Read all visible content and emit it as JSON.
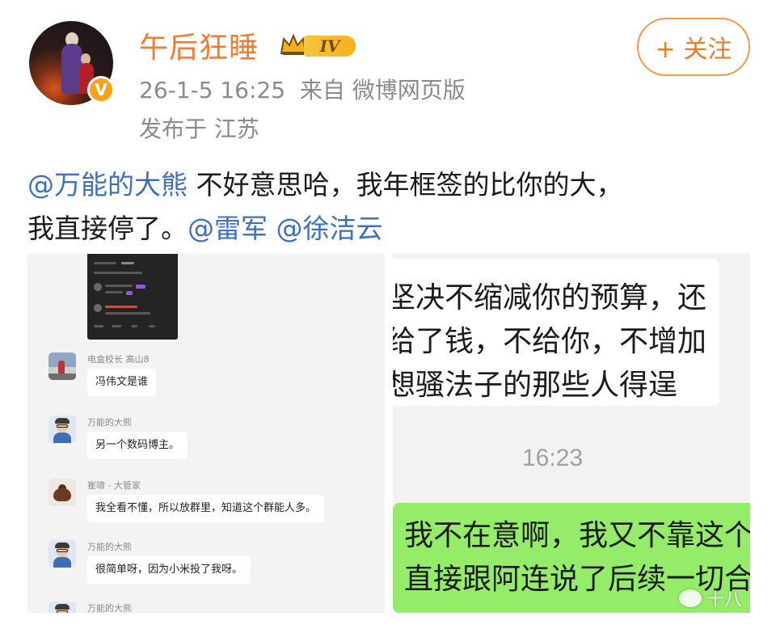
{
  "post": {
    "username": "午后狂睡",
    "level_badge": "IV",
    "verified_badge": "V",
    "timestamp": "26-1-5 16:25",
    "source": "来自 微博网页版",
    "location": "发布于 江苏",
    "follow_label": "+ 关注",
    "text": {
      "mention1": "@万能的大熊",
      "line1_rest": " 不好意思哈，我年框签的比你的大，",
      "line2_start": "我直接停了。",
      "mention2": "@雷军",
      "mention3": "@徐洁云"
    },
    "colors": {
      "username": "#f17b2e",
      "mention": "#3f6fbf",
      "follow": "#f07a22"
    }
  },
  "image_left": {
    "messages": [
      {
        "name": "电盒校长 高山8",
        "text": "冯伟文是谁",
        "avatar": "gaoshan-avatar"
      },
      {
        "name": "万能的大熊",
        "text": "另一个数码博主。",
        "avatar": "bear-avatar"
      },
      {
        "name": "崔啸 - 大管家",
        "text": "我全看不懂，所以放群里，知道这个群能人多。",
        "avatar": "teapot-avatar"
      },
      {
        "name": "万能的大熊",
        "text": "很简单呀，因为小米投了我呀。",
        "avatar": "bear-avatar"
      },
      {
        "name": "万能的大熊",
        "text": "",
        "avatar": "bear-avatar"
      }
    ]
  },
  "image_right": {
    "white_lines": [
      "坚决不缩减你的预算，还",
      "给了钱，不给你，不增加",
      "想骚法子的那些人得逞"
    ],
    "time": "16:23",
    "green_lines": [
      "我不在意啊，我又不靠这个",
      "直接跟阿连说了后续一切合"
    ],
    "colors": {
      "green_bubble": "#95ec69"
    }
  },
  "watermark": "十八"
}
